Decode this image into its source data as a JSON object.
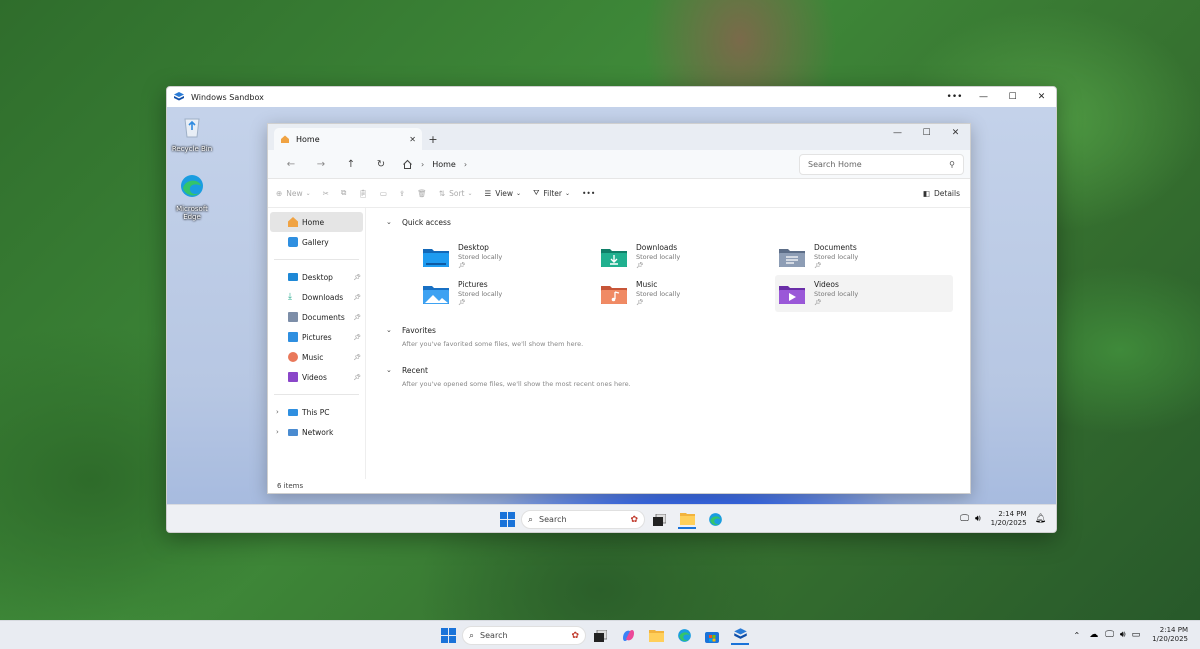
{
  "sandbox": {
    "title": "Windows Sandbox",
    "controls": {
      "more": "•••",
      "minimize": "—",
      "maximize": "☐",
      "close": "✕"
    },
    "desktop_icons": [
      {
        "label": "Recycle Bin",
        "icon": "recycle-bin-icon"
      },
      {
        "label": "Microsoft Edge",
        "icon": "edge-icon"
      }
    ],
    "taskbar": {
      "search_placeholder": "Search",
      "time": "2:14 PM",
      "date": "1/20/2025"
    }
  },
  "explorer": {
    "tab_title": "Home",
    "new_tab": "+",
    "tab_close": "✕",
    "window_controls": {
      "minimize": "—",
      "maximize": "☐",
      "close": "✕"
    },
    "address": {
      "root_sep": "›",
      "location": "Home",
      "trail_sep": "›"
    },
    "search_placeholder": "Search Home",
    "commands": {
      "new": "New",
      "sort": "Sort",
      "view": "View",
      "filter": "Filter",
      "more": "•••",
      "details": "Details"
    },
    "nav": {
      "home": "Home",
      "gallery": "Gallery",
      "pinned": [
        {
          "label": "Desktop",
          "icon": "desktop-folder-icon"
        },
        {
          "label": "Downloads",
          "icon": "downloads-icon"
        },
        {
          "label": "Documents",
          "icon": "documents-icon"
        },
        {
          "label": "Pictures",
          "icon": "pictures-icon"
        },
        {
          "label": "Music",
          "icon": "music-icon"
        },
        {
          "label": "Videos",
          "icon": "videos-icon"
        }
      ],
      "this_pc": "This PC",
      "network": "Network"
    },
    "quick_access": {
      "header": "Quick access",
      "items": [
        {
          "name": "Desktop",
          "sub": "Stored locally",
          "color": "#1e88d6"
        },
        {
          "name": "Downloads",
          "sub": "Stored locally",
          "color": "#20a88a"
        },
        {
          "name": "Documents",
          "sub": "Stored locally",
          "color": "#7d8ea8"
        },
        {
          "name": "Pictures",
          "sub": "Stored locally",
          "color": "#2f8fe0"
        },
        {
          "name": "Music",
          "sub": "Stored locally",
          "color": "#e9785a"
        },
        {
          "name": "Videos",
          "sub": "Stored locally",
          "color": "#8a46c9"
        }
      ]
    },
    "favorites": {
      "header": "Favorites",
      "note": "After you've favorited some files, we'll show them here."
    },
    "recent": {
      "header": "Recent",
      "note": "After you've opened some files, we'll show the most recent ones here."
    },
    "status": "6 items"
  },
  "host_taskbar": {
    "search_placeholder": "Search",
    "time": "2:14 PM",
    "date": "1/20/2025"
  }
}
